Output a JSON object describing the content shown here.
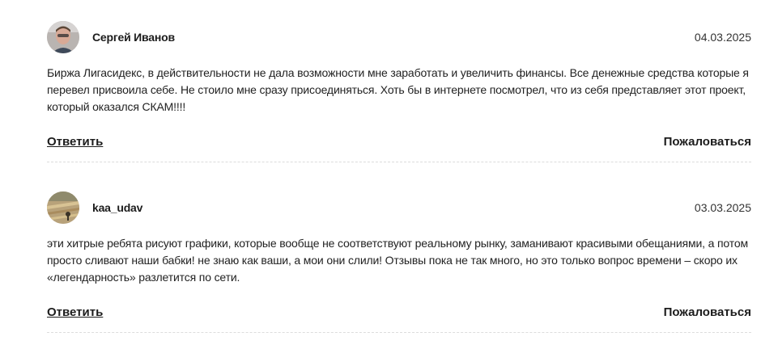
{
  "comments": [
    {
      "author": "Сергей Иванов",
      "date": "04.03.2025",
      "avatar": "user-photo-avatar",
      "text": "Биржа Лигасидекс, в действительности не дала возможности мне заработать и увеличить финансы. Все денежные средства которые я перевел присвоила себе. Не стоило мне сразу присоединяться. Хоть бы в интернете посмотрел, что из себя представляет этот проект, который оказался СКАМ!!!!",
      "reply_label": "Ответить",
      "report_label": "Пожаловаться"
    },
    {
      "author": "kaa_udav",
      "date": "03.03.2025",
      "avatar": "landscape-photo-avatar",
      "text": "эти хитрые ребята рисуют графики, которые вообще не соответствуют реальному рынку, заманивают красивыми обещаниями, а потом просто сливают наши бабки! не знаю как ваши, а мои они слили! Отзывы пока не так много, но это только вопрос времени – скоро их «легендарность» разлетится по сети.",
      "reply_label": "Ответить",
      "report_label": "Пожаловаться"
    }
  ]
}
